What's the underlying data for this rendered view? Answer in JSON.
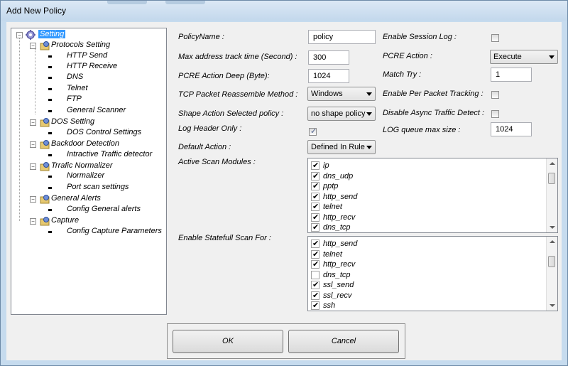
{
  "window": {
    "title": "Add New Policy"
  },
  "tree": {
    "root": {
      "label": "Setting"
    },
    "groups": [
      {
        "label": "Protocols Setting",
        "children": [
          "HTTP Send",
          "HTTP Receive",
          "DNS",
          "Telnet",
          "FTP",
          "General Scanner"
        ]
      },
      {
        "label": "DOS Setting",
        "children": [
          "DOS Control Settings"
        ]
      },
      {
        "label": "Backdoor Detection",
        "children": [
          "Intractive Traffic detector"
        ]
      },
      {
        "label": "Trrafic Normalizer",
        "children": [
          "Normalizer",
          "Port scan settings"
        ]
      },
      {
        "label": "General Alerts",
        "children": [
          "Config General alerts"
        ]
      },
      {
        "label": "Capture",
        "children": [
          "Config Capture Parameters"
        ]
      }
    ]
  },
  "form": {
    "policy_name": {
      "label": "PolicyName  :",
      "value": "policy"
    },
    "max_address_track": {
      "label": "Max address track time (Second) :",
      "value": "300"
    },
    "pcre_action_deep": {
      "label": "PCRE Action Deep (Byte):",
      "value": "1024"
    },
    "tcp_reassemble": {
      "label": "TCP Packet Reassemble Method :",
      "value": "Windows"
    },
    "shape_action": {
      "label": "Shape Action Selected policy :",
      "value": "no shape policy"
    },
    "log_header_only": {
      "label": "Log Header Only :",
      "checked": true
    },
    "default_action": {
      "label": "Default Action :",
      "value": "Defined In Rule"
    },
    "enable_session_log": {
      "label": "Enable Session Log :",
      "checked": false
    },
    "pcre_action": {
      "label": "PCRE Action :",
      "value": "Execute"
    },
    "match_try": {
      "label": "Match Try :",
      "value": "1"
    },
    "per_packet_tracking": {
      "label": "Enable Per Packet Tracking :",
      "checked": false
    },
    "disable_async": {
      "label": "Disable Async Traffic Detect :",
      "checked": false
    },
    "log_queue": {
      "label": "LOG queue max size :",
      "value": "1024"
    },
    "active_scan": {
      "label": "Active Scan Modules  :",
      "items": [
        {
          "name": "ip",
          "checked": true
        },
        {
          "name": "dns_udp",
          "checked": true
        },
        {
          "name": "pptp",
          "checked": true
        },
        {
          "name": "http_send",
          "checked": true
        },
        {
          "name": "telnet",
          "checked": true
        },
        {
          "name": "http_recv",
          "checked": true
        },
        {
          "name": "dns_tcp",
          "checked": true
        }
      ]
    },
    "statefull_scan": {
      "label": "Enable Statefull Scan For :",
      "items": [
        {
          "name": "http_send",
          "checked": true
        },
        {
          "name": "telnet",
          "checked": true
        },
        {
          "name": "http_recv",
          "checked": true
        },
        {
          "name": "dns_tcp",
          "checked": false
        },
        {
          "name": "ssl_send",
          "checked": true
        },
        {
          "name": "ssl_recv",
          "checked": true
        },
        {
          "name": "ssh",
          "checked": true
        }
      ]
    }
  },
  "buttons": {
    "ok": "OK",
    "cancel": "Cancel"
  }
}
